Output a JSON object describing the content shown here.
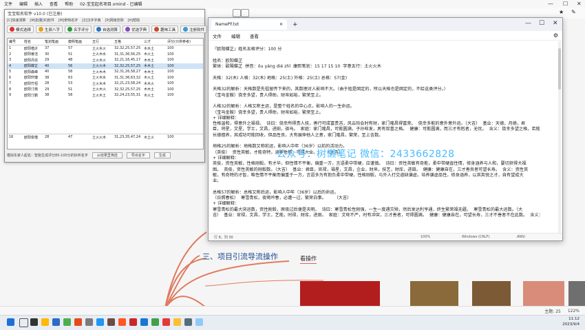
{
  "bg_app": {
    "menu": [
      "文件",
      "编辑",
      "插入",
      "查看",
      "帮助"
    ],
    "doc_title": "02-宝宝起名项目.xmind - 已编辑",
    "status": [
      "主题: 25",
      "122%"
    ]
  },
  "mindmap": {
    "node_title": "三、项目引流导流操作",
    "node_sub": "看操作"
  },
  "naming_app": {
    "title": "宝宝取名软件 v10.0 (已注册)",
    "menu": [
      "[C]快速测算",
      "[M]批量[R]软件",
      "[M]奇特名字",
      "[Z]汉字字典",
      "[P]网络范例",
      "[H]帮助"
    ],
    "toolbar": [
      "模式选择",
      "生辰八字",
      "名字评分",
      "自选测算",
      "优选字典",
      "趣味工具",
      "注册软件"
    ],
    "columns": [
      "编号",
      "姓名",
      "笔划笔画",
      "康熙笔画",
      "五行",
      "五格",
      "三才",
      "评分(只供参考)"
    ],
    "rows": [
      [
        "1",
        "欧阳楷沂",
        "37",
        "57",
        "土火水火",
        "32,32,25,57,25",
        "木木土",
        "100"
      ],
      [
        "2",
        "欧阳睿洁",
        "30",
        "51",
        "土火木水",
        "31,31,36,56,25",
        "木火土",
        "100"
      ],
      [
        "3",
        "欧阳丹炫",
        "29",
        "48",
        "土火木火",
        "32,21,16,45,17",
        "木木土",
        "100"
      ],
      [
        "4",
        "欧阳蝶芷",
        "40",
        "56",
        "土火火木",
        "32,32,25,57,25",
        "木木土",
        "100"
      ],
      [
        "5",
        "欧阳森峰",
        "40",
        "58",
        "土火木木",
        "32,31,26,58,27",
        "木木土",
        "100"
      ],
      [
        "6",
        "欧阳轩婕",
        "38",
        "63",
        "土火木水",
        "31,31,36,63,32",
        "木火土",
        "100"
      ],
      [
        "7",
        "欧阳竹桓",
        "28",
        "53",
        "土火木木",
        "32,21,23,58,24",
        "木木火",
        "100"
      ],
      [
        "8",
        "欧阳汀典",
        "29",
        "51",
        "土火木火",
        "32,32,25,57,25",
        "木木土",
        "100"
      ],
      [
        "9",
        "欧阳汀鹏",
        "38",
        "58",
        "土火木土",
        "32,24,23,55,31",
        "木火土",
        "100"
      ],
      [
        "16",
        "欧阳俊楷",
        "28",
        "47",
        "土火火木",
        "31,23,35,47,24",
        "木土火",
        "100"
      ]
    ],
    "footer_hint": "模拟东家人起名：智能生成评分85-100分的好听名字",
    "footer_buttons": [
      "从结果里筛选",
      "导出名字",
      "生成"
    ]
  },
  "notepad": {
    "tab": "NamePF.txt",
    "menu": [
      "文件",
      "编辑",
      "查看"
    ],
    "lines": [
      "",
      "『欧阳蝶芷』姓名五格评分：100 分",
      "",
      "姓名：欧阳蝶芷",
      "繁体：歐陽蝶芷  拼音：ōu yáng dié zhǐ  康熙笔划：15 17 15 10  字意五行：土火火木",
      "",
      "天格：32(木) 人格：32(木) 地格：25(土) 外格：25(土) 总格：57(金)",
      "",
      "天格32的解析：天格数是先祖留传下来的，其数理对人影响不大。（由于姓是固定的，所以天格也是固定的，不给这类评分。）",
      "（宝马金鞍）侥幸多望，贵人得助，财帛如裕，繁荣至上。",
      "",
      "人格32的解析：人格又称主运，是整个姓名的中心点，影响人的一生命运。",
      "（宝马金鞍）侥幸多望，贵人得助，财帛如裕，繁荣至上。",
      "+ 详细解释：",
      "性格温和，得意外之福禄。  诗曰：侥幸所得贵人扶，善行可成富贵吉，风云际会时有财，家门隆昌得富荣。  侥幸多能的意外意外运。（大吉）  基业：天德，月德，君",
      "臣，将星，文星，学士，文昌，进田，驿马。  家庭：家门隆昌，可能圆满，子孙旺发，男有双喜之格。  健康：可能圆满，而三才有剋者，无忧。  含义：侥幸多望之格，若能",
      "长德擅养，其成功可能回收，但品性良，大有展伸他人之意，家门隆昌，繁荣，至上吉数。",
      "",
      "地格25的解析：地格数又称前运，影响人中年（36岁）以前的活动力。",
      "（英俊）  资性英敏，才能奇特，涵养性情，可成大业。      （大吉）",
      "+ 详细解释：",
      "英俊，资性英敏，性格刚毅。有才华，但性情不平衡，偏重一方，言语柔中带硬，应谨慎。  诗曰：资性英敏有奇能，柔中带硬直性情，修身涵养与人和，要切获得大福",
      "图。  英俊，资性英敏的刚毅数。（大吉）  基业：君臣，官禄，福星，文昌，企业，财帛，技艺，财库，进田。  健康：健康自在，三才善良者可望长寿。  含义：资性英",
      "敏，有奇特的才智，唯性情不平衡而偏重于一方，言语多为有抱负柔中带硬，性格刚毅，与外人打交道缺谦虚。培养谦虚品性，修身涵养，以其英锐之才，自有望成大",
      "业。",
      "",
      "总格57的解析：总格又称后运，影响人中年（36岁）以后的命运。",
      "（日照春松）  寒雪青松，夜莺吟春，必遭一过，繁荣白事。      （大吉）",
      "+ 详细解释：",
      "寒雪青松的最大突运数，资性刚毅，厥夜过后便是天明。  诗曰：寒雪青松性刚强，一生一度遇灾殃，然后发达利亨通，终生繁荣福无疆。  寒雪青松的最大运数。（大",
      "吉）  基业：官禄，文昌，学士，艺能，时禄，财库，进田。  家庭：文旺不严，时有冲突，三才善者，可得圆满。  健康：健康自在，可望长寿，三才不善者不在此数。  含义："
    ],
    "status": [
      "行 8，列 30",
      "100%",
      "Windows (CRLF)",
      "ANSI"
    ]
  },
  "watermark": "公众号：树懒笔记   微信：2433662828",
  "tray": {
    "time": "11:12",
    "date": "2023/9/4"
  },
  "colors": {
    "blue_link": "#1a4a8c",
    "accent": "#36b4ff",
    "selection": "#cfe3f7"
  }
}
